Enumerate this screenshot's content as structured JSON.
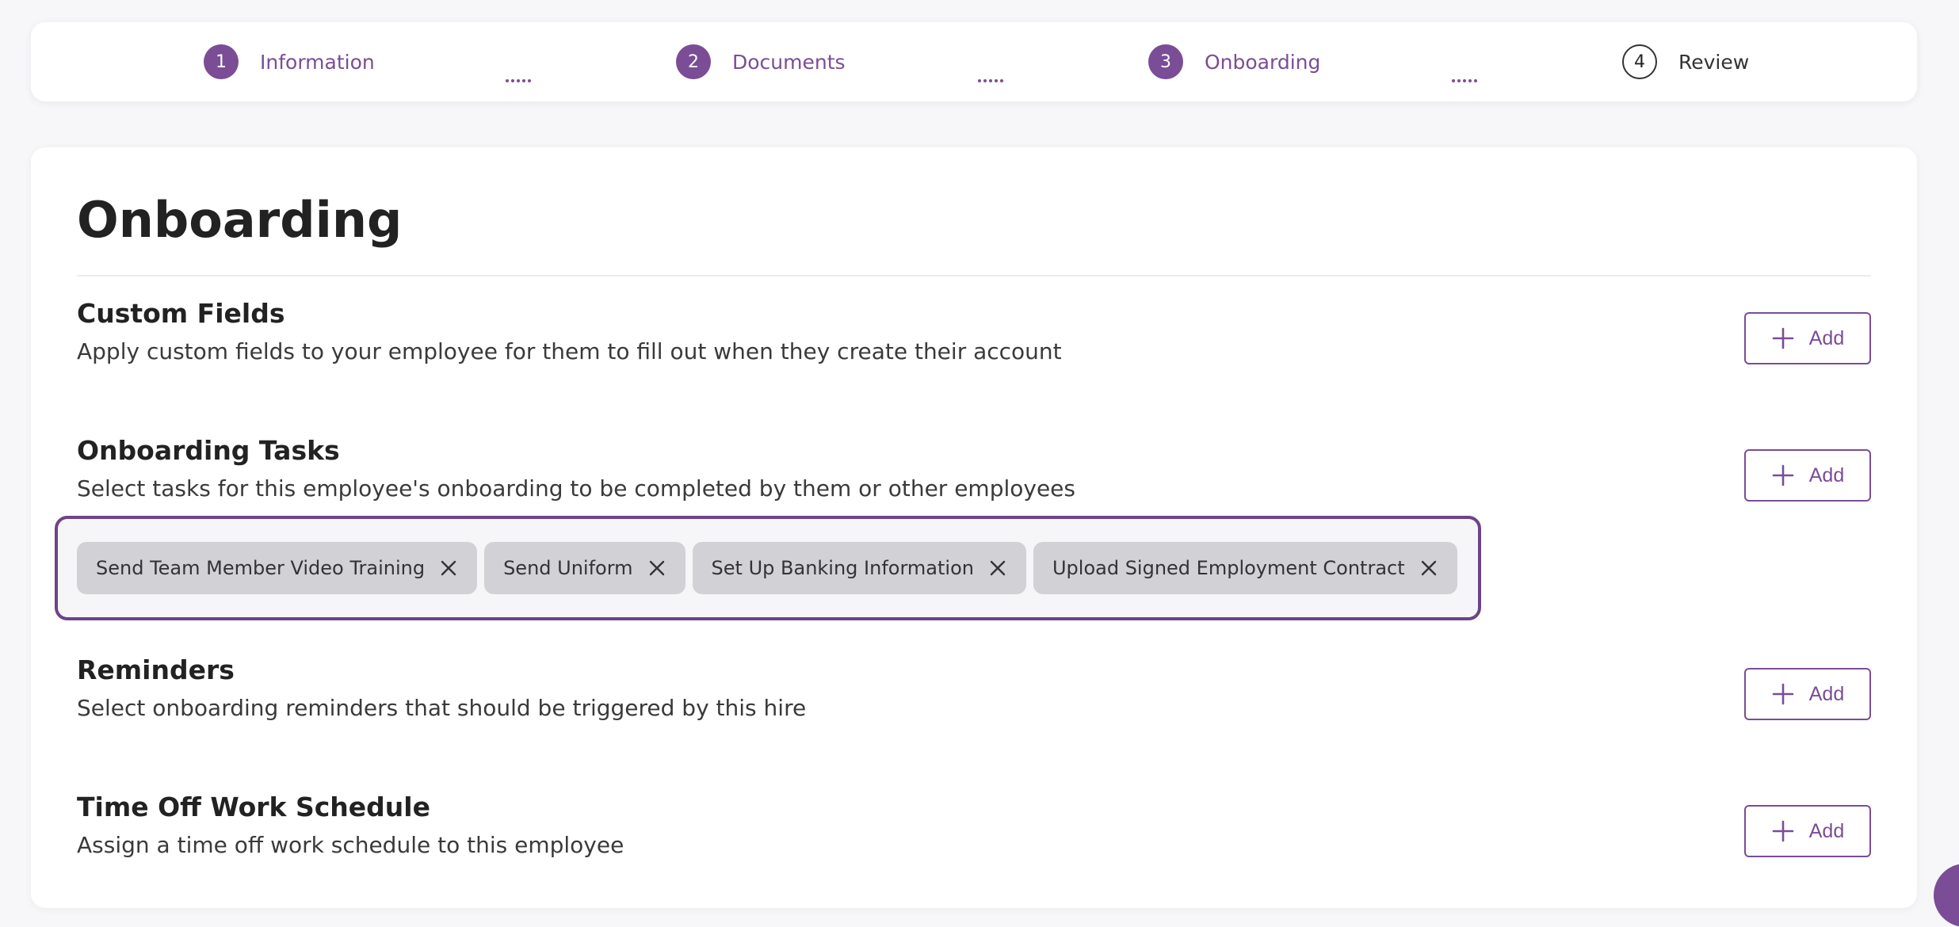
{
  "stepper": {
    "steps": [
      {
        "number": "1",
        "label": "Information",
        "state": "complete"
      },
      {
        "number": "2",
        "label": "Documents",
        "state": "complete"
      },
      {
        "number": "3",
        "label": "Onboarding",
        "state": "current"
      },
      {
        "number": "4",
        "label": "Review",
        "state": "upcoming"
      }
    ]
  },
  "page": {
    "title": "Onboarding"
  },
  "sections": {
    "custom_fields": {
      "title": "Custom Fields",
      "description": "Apply custom fields to your employee for them to fill out when they create their account",
      "add_label": "Add"
    },
    "onboarding_tasks": {
      "title": "Onboarding Tasks",
      "description": "Select tasks for this employee's onboarding to be completed by them or other employees",
      "add_label": "Add",
      "tags": [
        {
          "label": "Send Team Member Video Training"
        },
        {
          "label": "Send Uniform"
        },
        {
          "label": "Set Up Banking Information"
        },
        {
          "label": "Upload Signed Employment Contract"
        }
      ]
    },
    "reminders": {
      "title": "Reminders",
      "description": "Select onboarding reminders that should be triggered by this hire",
      "add_label": "Add"
    },
    "time_off": {
      "title": "Time Off Work Schedule",
      "description": "Assign a time off work schedule to this employee",
      "add_label": "Add"
    }
  },
  "icons": {
    "add": "plus-icon",
    "remove_tag": "close-icon",
    "step_separator": "dotted-line-icon"
  },
  "colors": {
    "accent": "#7a4d96",
    "tag_background": "#d2d2d6",
    "focus_border": "#6e4387",
    "page_background": "#f7f7f9"
  }
}
